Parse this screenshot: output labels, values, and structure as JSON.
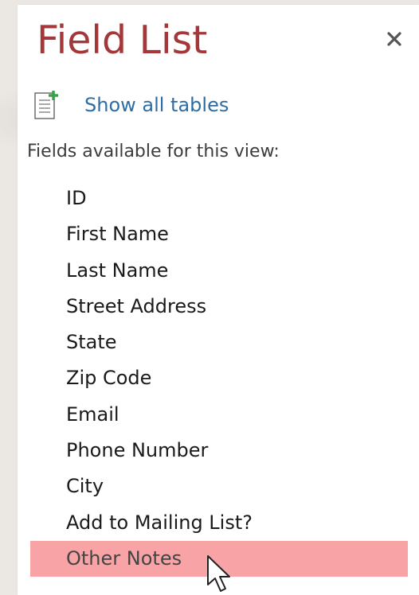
{
  "panel": {
    "title": "Field List",
    "close_icon": "close-icon",
    "show_all_tables": {
      "icon": "add-table-icon",
      "label": "Show all tables"
    },
    "fields_heading": "Fields available for this view:",
    "fields": [
      "ID",
      "First Name",
      "Last Name",
      "Street Address",
      "State",
      "Zip Code",
      "Email",
      "Phone Number",
      "City",
      "Add to Mailing List?",
      "Other Notes"
    ],
    "selected_field": "Other Notes"
  },
  "colors": {
    "title": "#a4373a",
    "link": "#2e6da4",
    "selection": "#f8a4a6"
  },
  "cursor_icon": "arrow-cursor-icon"
}
